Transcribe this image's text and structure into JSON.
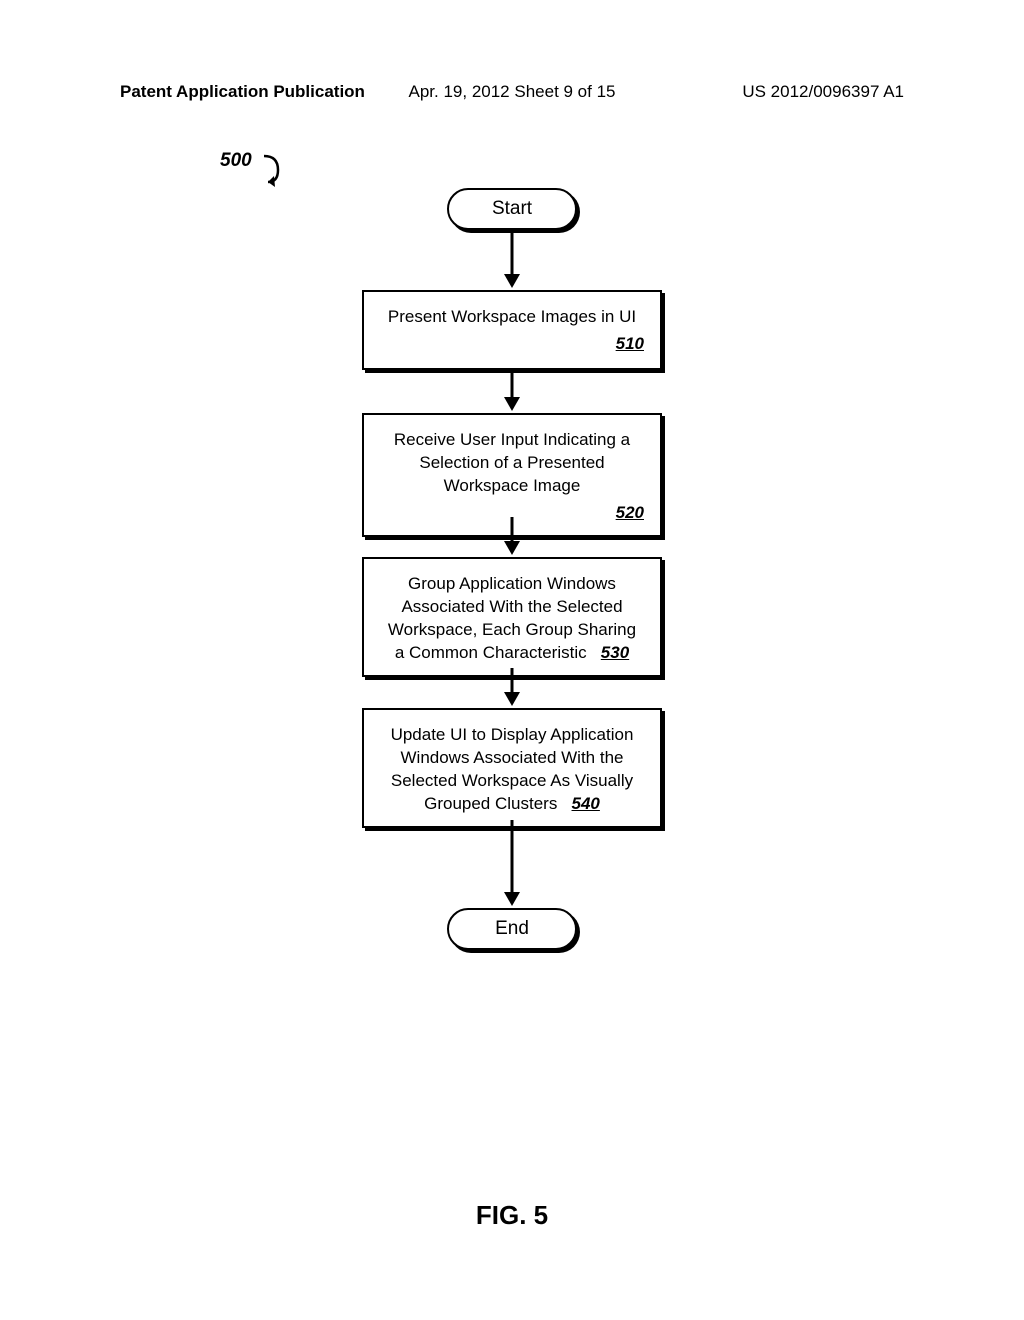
{
  "header": {
    "left": "Patent Application Publication",
    "center": "Apr. 19, 2012  Sheet 9 of 15",
    "right": "US 2012/0096397 A1"
  },
  "flowchart": {
    "ref": "500",
    "start": "Start",
    "end": "End",
    "steps": [
      {
        "text": "Present Workspace Images in UI",
        "ref": "510"
      },
      {
        "text": "Receive User Input Indicating a Selection of a Presented Workspace Image",
        "ref": "520"
      },
      {
        "text": "Group Application Windows Associated With the Selected Workspace, Each Group Sharing a Common Characteristic",
        "ref": "530"
      },
      {
        "text": "Update UI to Display Application Windows Associated With the Selected Workspace As Visually Grouped Clusters",
        "ref": "540"
      }
    ]
  },
  "figure_label": "FIG. 5"
}
